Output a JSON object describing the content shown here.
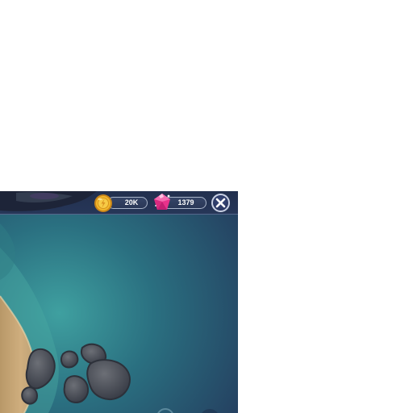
{
  "hud": {
    "coins": {
      "value": "20K",
      "icon": "gold-coin-icon"
    },
    "gems": {
      "value": "1379",
      "icon": "pink-gem-icon"
    },
    "close": {
      "icon": "close-icon"
    }
  },
  "colors": {
    "bar": "#22304e",
    "pill_border": "#a7b3c8",
    "water": "#24566a",
    "sand": "#c9a878",
    "rock": "#3d4452",
    "coin": "#f1b72b",
    "gem": "#e8328b"
  }
}
